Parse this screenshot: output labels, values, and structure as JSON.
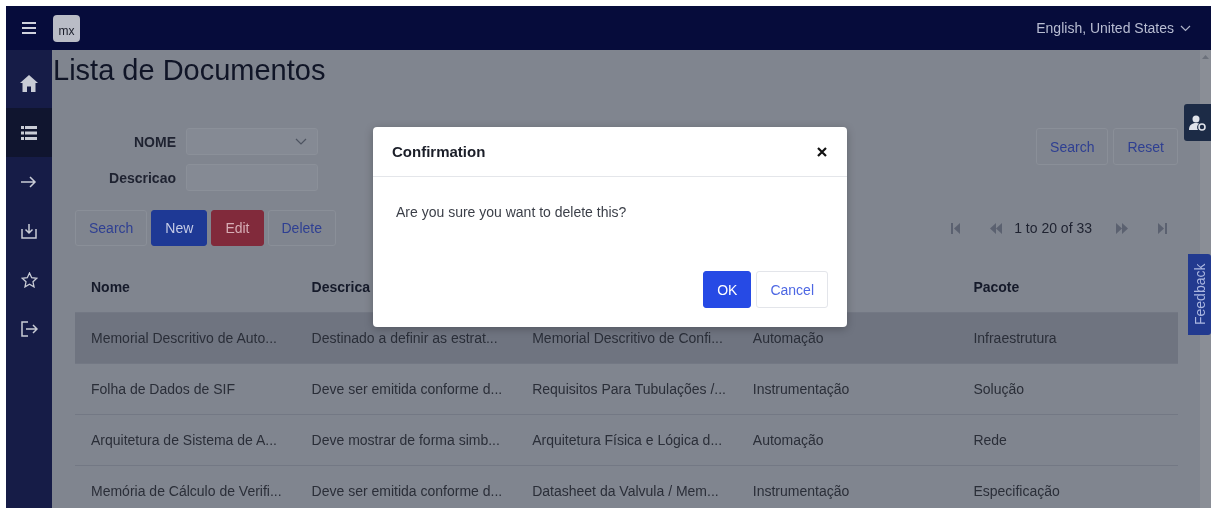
{
  "top_bar": {
    "logo": "mx",
    "language": "English, United States"
  },
  "sidebar": {
    "items": [
      {
        "kind": "home",
        "selected": false
      },
      {
        "kind": "list",
        "selected": true
      },
      {
        "kind": "arrow",
        "selected": false
      },
      {
        "kind": "download",
        "selected": false
      },
      {
        "kind": "star",
        "selected": false
      },
      {
        "kind": "logout",
        "selected": false
      }
    ]
  },
  "page": {
    "title": "Lista de Documentos"
  },
  "filters": [
    {
      "label": "NOME",
      "kind": "select"
    },
    {
      "label": "Descricao",
      "kind": "text"
    }
  ],
  "filter_buttons": [
    "Search",
    "Reset"
  ],
  "toolbar_buttons": [
    {
      "label": "Search",
      "kind": "default"
    },
    {
      "label": "New",
      "kind": "primary"
    },
    {
      "label": "Edit",
      "kind": "danger"
    },
    {
      "label": "Delete",
      "kind": "default"
    }
  ],
  "pagination": {
    "text": "1 to 20 of 33"
  },
  "table": {
    "header": {
      "nome": "Nome",
      "descricao": "Descrica",
      "pacote": "Pacote"
    },
    "rows": [
      {
        "selected": true,
        "cells": [
          "Memorial Descritivo de Auto...",
          "Destinado a definir as estrat...",
          "Memorial Descritivo de Confi...",
          "Automação",
          "Infraestrutura"
        ]
      },
      {
        "selected": false,
        "cells": [
          "Folha de Dados de SIF",
          "Deve ser emitida conforme d...",
          "Requisitos Para Tubulações /...",
          "Instrumentação",
          "Solução"
        ]
      },
      {
        "selected": false,
        "cells": [
          "Arquitetura de Sistema de A...",
          "Deve mostrar de forma simb...",
          "Arquitetura Física e Lógica d...",
          "Automação",
          "Rede"
        ]
      },
      {
        "selected": false,
        "cells": [
          "Memória de Cálculo de Verifi...",
          "Deve ser emitida conforme d...",
          "Datasheet da Valvula / Mem...",
          "Instrumentação",
          "Especificação"
        ]
      }
    ]
  },
  "dialog": {
    "title": "Confirmation",
    "message": "Are you sure you want to delete this?",
    "buttons": [
      {
        "label": "OK",
        "kind": "primary"
      },
      {
        "label": "Cancel",
        "kind": "default"
      }
    ]
  },
  "side_tabs": {
    "feedback": "Feedback"
  }
}
